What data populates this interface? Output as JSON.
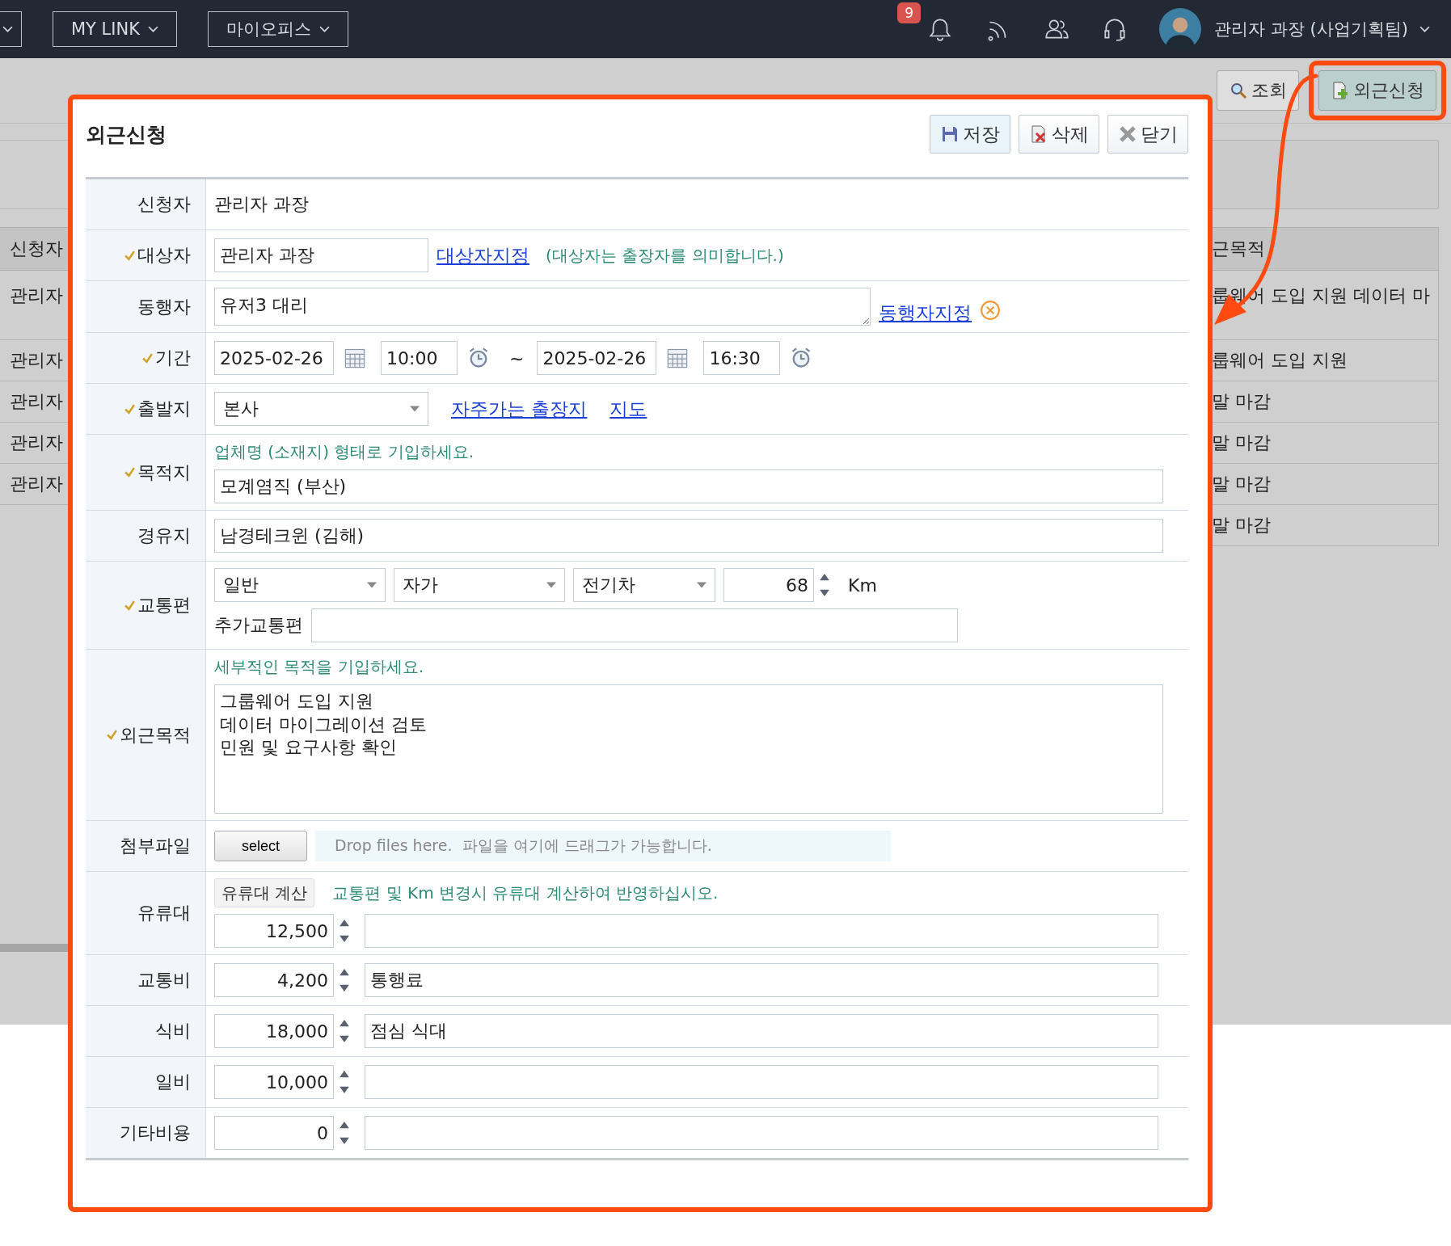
{
  "top_bar": {
    "menus": [
      {
        "label": "MY LINK"
      },
      {
        "label": "마이오피스"
      }
    ],
    "notification_count": "9",
    "user": "관리자 과장 (사업기획팀)"
  },
  "list_page": {
    "toolbar_buttons": [
      {
        "label": "조회",
        "kind": "search",
        "highlighted": false
      },
      {
        "label": "외근신청",
        "kind": "add",
        "highlighted": true
      }
    ],
    "left_column": {
      "header": "신청자",
      "cells": [
        "관리자",
        "관리자",
        "관리자",
        "관리자",
        "관리자"
      ]
    },
    "right_column": {
      "header": "근목적",
      "cells": [
        "룹웨어 도입 지원 데이터 마",
        "룹웨어 도입 지원",
        "말 마감",
        "말 마감",
        "말 마감",
        "말 마감"
      ]
    }
  },
  "dialog": {
    "title": "외근신청",
    "buttons": [
      {
        "label": "저장",
        "kind": "save",
        "highlighted": true
      },
      {
        "label": "삭제",
        "kind": "delete",
        "highlighted": false
      },
      {
        "label": "닫기",
        "kind": "close",
        "highlighted": false
      }
    ],
    "fields": [
      {
        "label": "신청자",
        "required": false,
        "kind": "static",
        "value": "관리자 과장"
      },
      {
        "label": "대상자",
        "required": true,
        "kind": "input_link",
        "value": "관리자 과장",
        "link": "대상자지정",
        "note": "(대상자는 출장자를 의미합니다.)"
      },
      {
        "label": "동행자",
        "required": false,
        "kind": "textarea_link",
        "value": "유저3 대리",
        "link": "동행자지정"
      },
      {
        "label": "기간",
        "required": true,
        "kind": "period",
        "start_date": "2025-02-26",
        "start_time": "10:00",
        "separator": "~",
        "end_date": "2025-02-26",
        "end_time": "16:30"
      },
      {
        "label": "출발지",
        "required": true,
        "kind": "select_links",
        "value": "본사",
        "links": [
          "자주가는 출장지",
          "지도"
        ]
      },
      {
        "label": "목적지",
        "required": true,
        "kind": "hint_input",
        "hint": "업체명 (소재지) 형태로 기입하세요.",
        "value": "모계염직 (부산)"
      },
      {
        "label": "경유지",
        "required": false,
        "kind": "input",
        "value": "남경테크윈 (김해)"
      },
      {
        "label": "교통편",
        "required": true,
        "kind": "transport",
        "selects": [
          "일반",
          "자가",
          "전기차"
        ],
        "distance": "68",
        "unit": "Km",
        "extra_label": "추가교통편"
      },
      {
        "label": "외근목적",
        "required": true,
        "kind": "hint_textarea",
        "hint": "세부적인 목적을 기입하세요.",
        "value": "그룹웨어 도입 지원\n데이터 마이그레이션 검토\n민원 및 요구사항 확인"
      },
      {
        "label": "첨부파일",
        "required": false,
        "kind": "attachment",
        "button": "select",
        "drop_text": "Drop files here.  파일을 여기에 드래그가 가능합니다."
      },
      {
        "label": "유류대",
        "required": false,
        "kind": "fuel",
        "button": "유류대 계산",
        "hint": "교통편 및 Km 변경시 유류대 계산하여 반영하십시오.",
        "amount": "12,500"
      },
      {
        "label": "교통비",
        "required": false,
        "kind": "cost",
        "amount": "4,200",
        "memo": "통행료"
      },
      {
        "label": "식비",
        "required": false,
        "kind": "cost",
        "amount": "18,000",
        "memo": "점심 식대"
      },
      {
        "label": "일비",
        "required": false,
        "kind": "cost",
        "amount": "10,000"
      },
      {
        "label": "기타비용",
        "required": false,
        "kind": "cost",
        "amount": "0"
      }
    ]
  }
}
